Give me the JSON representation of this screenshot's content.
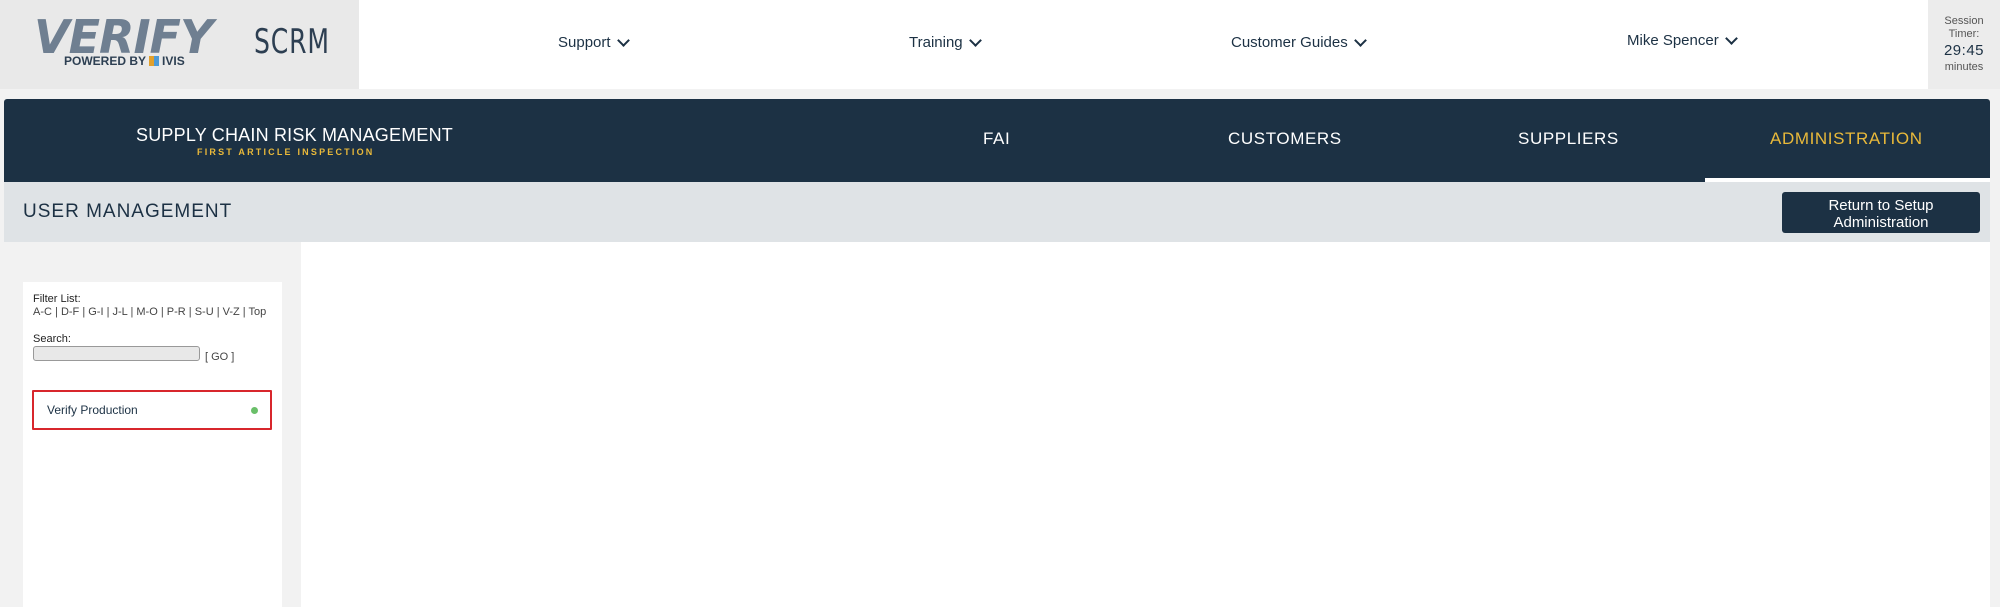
{
  "brand": {
    "logo_word": "VERIFY",
    "logo_powered_prefix": "POWERED BY",
    "logo_powered_name": "IVIS",
    "product": "SCRM"
  },
  "top_nav": {
    "support": "Support",
    "training": "Training",
    "customer_guides": "Customer Guides",
    "user": "Mike Spencer"
  },
  "session": {
    "label_line1": "Session",
    "label_line2": "Timer:",
    "time": "29:45",
    "unit": "minutes"
  },
  "main_nav": {
    "title": "SUPPLY CHAIN RISK MANAGEMENT",
    "subtitle": "FIRST ARTICLE INSPECTION",
    "items": [
      "FAI",
      "CUSTOMERS",
      "SUPPLIERS",
      "ADMINISTRATION"
    ],
    "active": "ADMINISTRATION"
  },
  "section": {
    "title": "USER MANAGEMENT",
    "return_line1": "Return to Setup",
    "return_line2": "Administration"
  },
  "filter": {
    "label": "Filter List:",
    "ranges": [
      "A-C",
      "D-F",
      "G-I",
      "J-L",
      "M-O",
      "P-R",
      "S-U",
      "V-Z",
      "Top"
    ],
    "search_label": "Search:",
    "search_value": "",
    "go_label": "[ GO ]"
  },
  "list": {
    "items": [
      {
        "label": "Verify Production",
        "status_color": "#6abf69"
      }
    ]
  },
  "colors": {
    "navy": "#1c3144",
    "accent_gold": "#e9b93a",
    "selection_red": "#d8262c"
  }
}
